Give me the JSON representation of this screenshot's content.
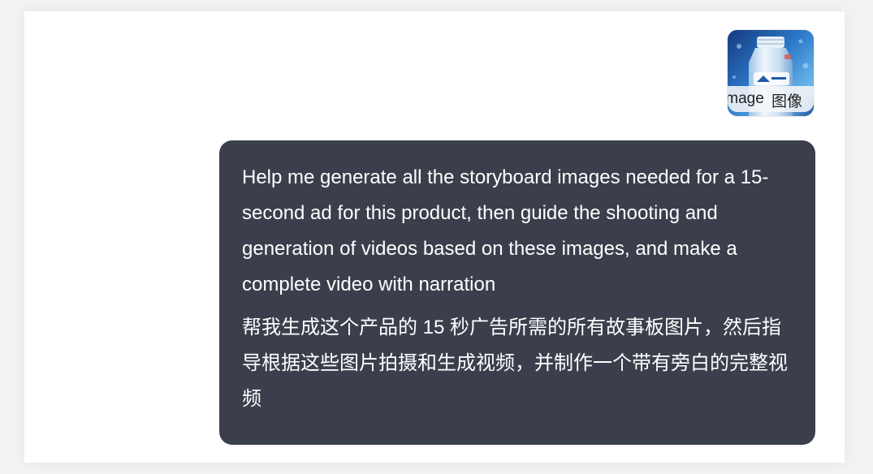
{
  "attachment": {
    "caption_en": "Image",
    "caption_zh": "图像",
    "colors": {
      "bottle": "#dceaf6",
      "background": "#2b73c6",
      "cap": "#e8f0f7"
    }
  },
  "message": {
    "text_en": "Help me generate all the storyboard images needed for a 15-second ad for this product, then guide the shooting and generation of videos based on these images, and make a complete video with narration",
    "text_zh": "帮我生成这个产品的 15 秒广告所需的所有故事板图片，然后指导根据这些图片拍摄和生成视频，并制作一个带有旁白的完整视频",
    "bubble_color": "#3a3f4b",
    "text_color": "#ffffff"
  }
}
